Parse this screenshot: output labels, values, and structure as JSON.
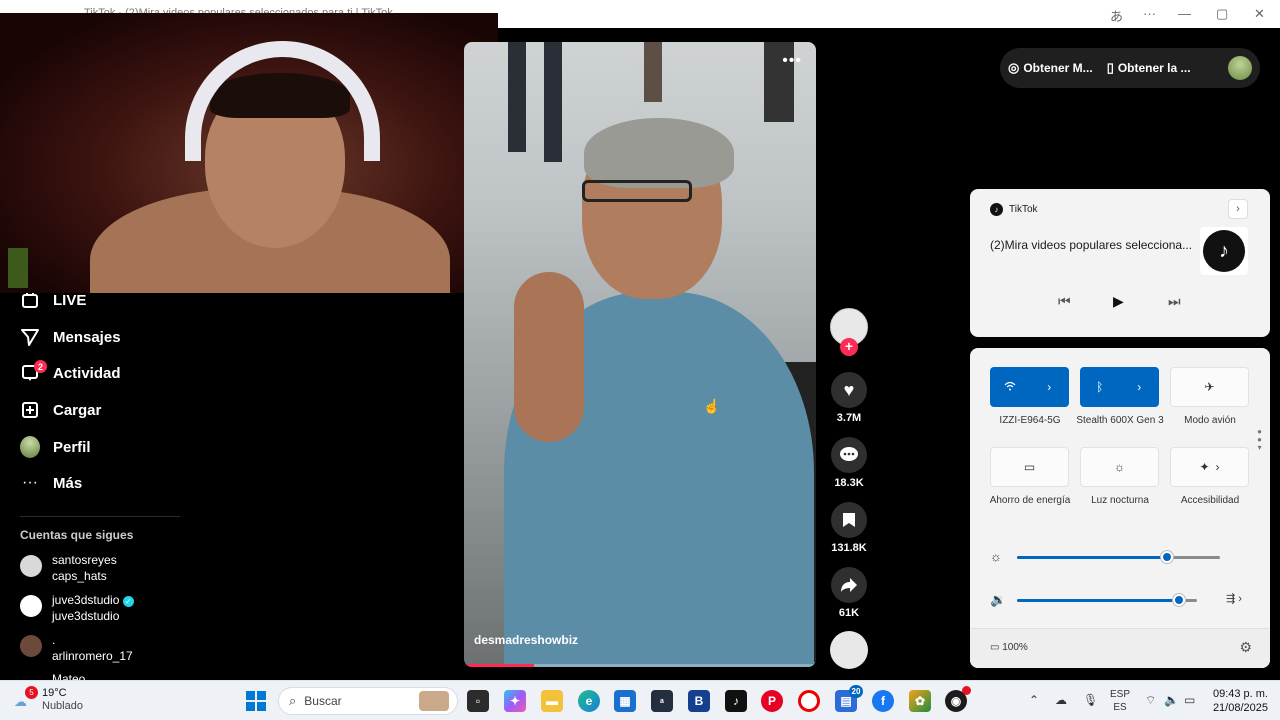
{
  "browser": {
    "tab_title": "TikTok - (2)Mira videos populares seleccionados para ti | TikTok",
    "translate_icon": "translate-icon",
    "more": "···",
    "minimize": "—",
    "maximize": "▢",
    "close": "✕"
  },
  "sidebar": {
    "items": [
      {
        "label": "LIVE",
        "icon": "live-icon"
      },
      {
        "label": "Mensajes",
        "icon": "messages-icon"
      },
      {
        "label": "Actividad",
        "icon": "activity-icon",
        "badge": "2"
      },
      {
        "label": "Cargar",
        "icon": "upload-icon"
      },
      {
        "label": "Perfil",
        "icon": "profile-icon"
      },
      {
        "label": "Más",
        "icon": "more-icon"
      }
    ],
    "following_title": "Cuentas que sigues",
    "following": [
      {
        "name": "santosreyes",
        "handle": "caps_hats"
      },
      {
        "name": "juve3dstudio",
        "handle": "juve3dstudio",
        "verified": true
      },
      {
        "name": ".",
        "handle": "arlinromero_17"
      },
      {
        "name": "Mateo",
        "handle": ""
      }
    ]
  },
  "video": {
    "author": "desmadreshowbiz",
    "more": "•••",
    "progress": 0.2
  },
  "actions": {
    "likes": "3.7M",
    "comments": "18.3K",
    "saves": "131.8K",
    "shares": "61K"
  },
  "get_pill": {
    "item1": "Obtener M...",
    "item2": "Obtener la ..."
  },
  "media": {
    "app": "TikTok",
    "title": "(2)Mira videos populares selecciona...",
    "prev": "⏮",
    "play": "▶",
    "next": "⏭"
  },
  "quick_settings": {
    "tiles": [
      {
        "label": "IZZI-E964-5G",
        "on": true,
        "icon": "wifi-icon"
      },
      {
        "label": "Stealth 600X Gen 3",
        "on": true,
        "icon": "bluetooth-icon"
      },
      {
        "label": "Modo avión",
        "on": false,
        "icon": "airplane-icon"
      },
      {
        "label": "Ahorro de energía",
        "on": false,
        "icon": "battery-saver-icon"
      },
      {
        "label": "Luz nocturna",
        "on": false,
        "icon": "night-light-icon"
      },
      {
        "label": "Accesibilidad",
        "on": false,
        "icon": "accessibility-icon"
      }
    ],
    "brightness": 0.74,
    "volume": 0.9,
    "battery": "100%"
  },
  "taskbar": {
    "weather_temp": "19°C",
    "weather_desc": "Nublado",
    "weather_badge": "5",
    "search_placeholder": "Buscar",
    "lang_top": "ESP",
    "lang_bottom": "ES",
    "time": "09:43 p. m.",
    "date": "21/08/2025",
    "teams_badge": "20"
  },
  "colors": {
    "tiktok_red": "#fe2c55",
    "accent_blue": "#0067c0"
  }
}
